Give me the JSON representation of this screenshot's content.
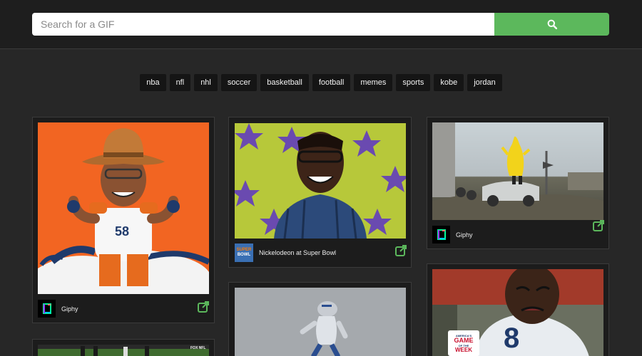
{
  "search": {
    "placeholder": "Search for a GIF",
    "value": "",
    "button_icon": "search-icon"
  },
  "tags": [
    "nba",
    "nfl",
    "nhl",
    "soccer",
    "basketball",
    "football",
    "memes",
    "sports",
    "kobe",
    "jordan"
  ],
  "cards": [
    {
      "source": "Giphy",
      "avatar": "giphy-logo",
      "image": "cartoon cowboy football player riding horse"
    },
    {
      "source": "Nickelodeon at Super Bowl",
      "avatar": "super-bowl-logo",
      "image": "man smiling in front of stars"
    },
    {
      "source": "Giphy",
      "avatar": "giphy-logo",
      "image": "person in banana costume on car"
    },
    {
      "source": "",
      "avatar": "",
      "image": "football field scene"
    },
    {
      "source": "",
      "avatar": "",
      "image": "football player spinning"
    },
    {
      "source": "",
      "avatar": "",
      "image": "crying football player game of the week"
    }
  ],
  "overlay_text": {
    "superbowl_line1": "SUPER",
    "superbowl_line2": "BOWL",
    "jersey_number": "58",
    "gotw_line1": "AMERICA'S",
    "gotw_line2": "GAME",
    "gotw_line3": "OF THE",
    "gotw_line4": "WEEK",
    "fox_bug": "FOX NFL"
  },
  "colors": {
    "accent": "#5cb85c",
    "background": "#272727",
    "card": "#1c1c1c"
  }
}
